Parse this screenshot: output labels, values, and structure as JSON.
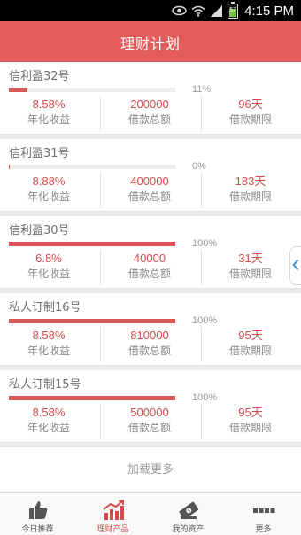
{
  "status_bar": {
    "time": "4:15 PM",
    "battery_level": "57"
  },
  "header": {
    "title": "理财计划"
  },
  "products": [
    {
      "name": "信利盈32号",
      "progress": 0.11,
      "progress_label": "11%",
      "rate": "8.58%",
      "rate_label": "年化收益",
      "amount": "200000",
      "amount_label": "借款总额",
      "term": "96天",
      "term_label": "借款期限"
    },
    {
      "name": "信利盈31号",
      "progress": 0.0,
      "progress_label": "0%",
      "rate": "8.88%",
      "rate_label": "年化收益",
      "amount": "400000",
      "amount_label": "借款总额",
      "term": "183天",
      "term_label": "借款期限"
    },
    {
      "name": "信利盈30号",
      "progress": 1.0,
      "progress_label": "100%",
      "rate": "6.8%",
      "rate_label": "年化收益",
      "amount": "40000",
      "amount_label": "借款总额",
      "term": "31天",
      "term_label": "借款期限"
    },
    {
      "name": "私人订制16号",
      "progress": 1.0,
      "progress_label": "100%",
      "rate": "8.58%",
      "rate_label": "年化收益",
      "amount": "810000",
      "amount_label": "借款总额",
      "term": "95天",
      "term_label": "借款期限"
    },
    {
      "name": "私人订制15号",
      "progress": 1.0,
      "progress_label": "100%",
      "rate": "8.58%",
      "rate_label": "年化收益",
      "amount": "500000",
      "amount_label": "借款总额",
      "term": "95天",
      "term_label": "借款期限"
    }
  ],
  "load_more": "加载更多",
  "tabs": [
    {
      "label": "今日推荐",
      "icon": "thumbs-up-icon",
      "active": false
    },
    {
      "label": "理财产品",
      "icon": "bar-chart-icon",
      "active": true
    },
    {
      "label": "我的资产",
      "icon": "money-icon",
      "active": false
    },
    {
      "label": "更多",
      "icon": "more-icon",
      "active": false
    }
  ],
  "colors": {
    "accent": "#e35b5b",
    "value_red": "#d54b4b",
    "active_tab": "#d54b4b"
  }
}
